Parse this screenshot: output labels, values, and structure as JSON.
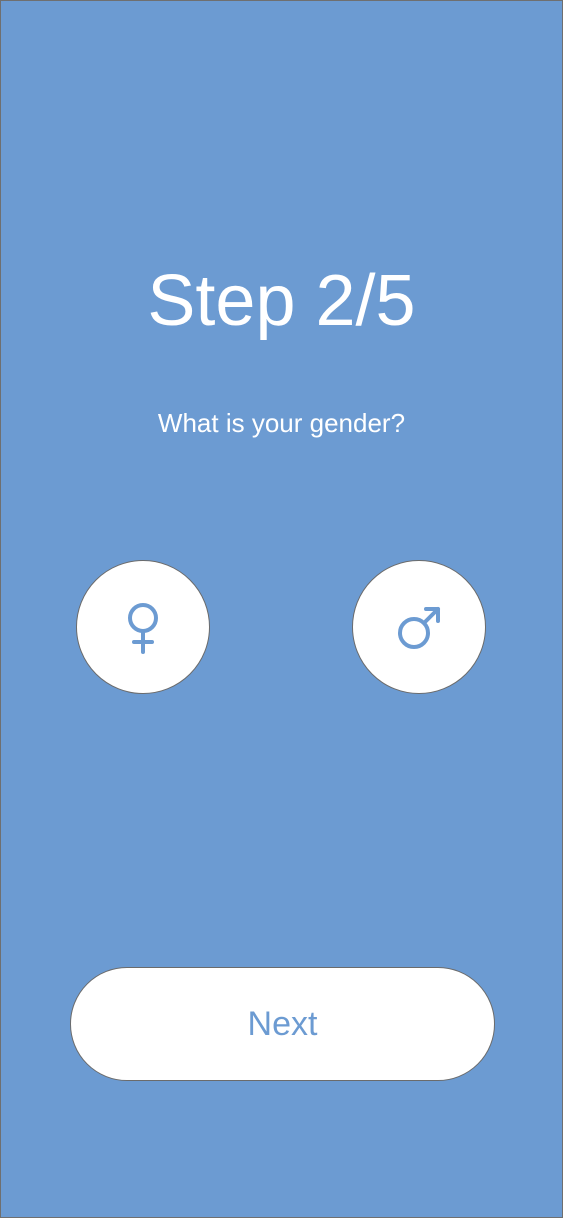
{
  "header": {
    "step_title": "Step 2/5"
  },
  "question": {
    "text": "What is your gender?"
  },
  "options": [
    {
      "name": "female",
      "icon": "female-symbol-icon"
    },
    {
      "name": "male",
      "icon": "male-symbol-icon"
    }
  ],
  "actions": {
    "next_label": "Next"
  },
  "colors": {
    "background": "#6c9bd2",
    "accent": "#6c9bd2",
    "button_fill": "#ffffff",
    "border": "#6b6b6b"
  }
}
